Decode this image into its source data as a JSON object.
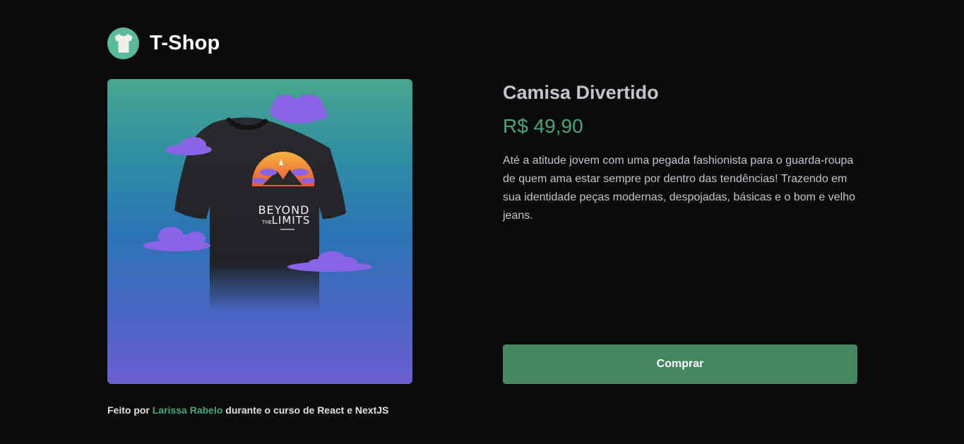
{
  "header": {
    "brand": "T-Shop",
    "logo_icon": "tshirt-icon",
    "logo_color": "#5bb99b"
  },
  "product": {
    "name": "Camisa Divertido",
    "price": "R$ 49,90",
    "description": "Até a atitude jovem com uma pegada fashionista para o guarda-roupa de quem ama estar sempre por dentro das tendências! Trazendo em sua identidade peças modernas, despojadas, básicas e o bom e velho jeans.",
    "image": {
      "print_line1": "BEYOND",
      "print_line2": "THE",
      "print_line3": "LIMITS",
      "gradient_top": "#4aa58e",
      "gradient_bottom": "#6b5ed0"
    }
  },
  "actions": {
    "buy_label": "Comprar",
    "buy_color": "#43865f"
  },
  "footer": {
    "prefix": "Feito por ",
    "author": "Larissa Rabelo",
    "suffix": " durante o curso de React e NextJS"
  },
  "colors": {
    "background": "#0a0a0b",
    "accent": "#4aa77a"
  }
}
